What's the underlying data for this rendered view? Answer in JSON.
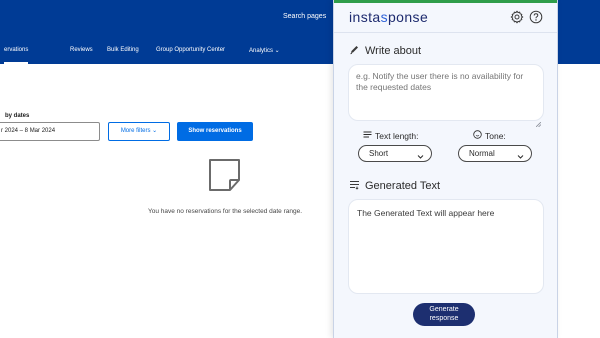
{
  "background_page": {
    "search_text": "Search pages",
    "nav": {
      "items": [
        {
          "label": "ervations",
          "active": true
        },
        {
          "label": "Reviews",
          "active": false
        },
        {
          "label": "Bulk Editing",
          "active": false
        },
        {
          "label": "Group Opportunity Center",
          "active": false
        },
        {
          "label": "Analytics ⌄",
          "active": false
        }
      ]
    },
    "filter": {
      "label": "by dates",
      "date_range": "r 2024 – 8 Mar 2024",
      "more_filters_label": "More filters ⌄",
      "show_reservations_label": "Show reservations"
    },
    "empty_state": {
      "icon": "note-icon",
      "message": "You have no reservations for the selected date range."
    }
  },
  "panel": {
    "brand": {
      "part1": "insta",
      "part2": "s",
      "part3": "ponse"
    },
    "header_icons": {
      "settings": "gear-icon",
      "help": "help-icon"
    },
    "write_about": {
      "title": "Write about",
      "icon": "pencil-icon",
      "placeholder": "e.g. Notify the user there is no availability for the requested dates"
    },
    "text_length": {
      "label": "Text length:",
      "icon": "lines-icon",
      "selected": "Short"
    },
    "tone": {
      "label": "Tone:",
      "icon": "smiley-icon",
      "selected": "Normal"
    },
    "generated": {
      "title": "Generated Text",
      "icon": "text-lines-icon",
      "content": "The Generated Text will appear here"
    },
    "generate_button": {
      "label": "Generate response"
    }
  },
  "colors": {
    "booking_blue": "#003b95",
    "booking_button": "#006ce4",
    "panel_bg": "#f4f7fd",
    "brand_navy": "#1d2a6e",
    "generate_button": "#1d2f70"
  }
}
